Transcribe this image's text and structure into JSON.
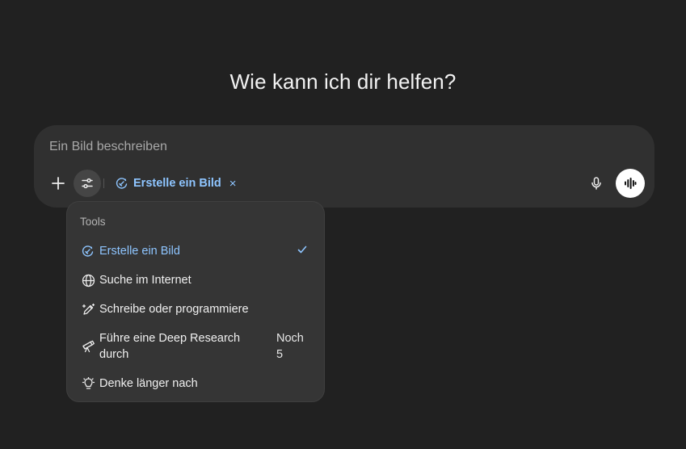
{
  "heading": "Wie kann ich dir helfen?",
  "composer": {
    "placeholder": "Ein Bild beschreiben",
    "active_tool_chip": "Erstelle ein Bild",
    "chip_remove": "×"
  },
  "tools_menu": {
    "header": "Tools",
    "items": [
      {
        "label": "Erstelle ein Bild",
        "icon": "image-create-icon",
        "selected": true
      },
      {
        "label": "Suche im Internet",
        "icon": "globe-icon"
      },
      {
        "label": "Schreibe oder programmiere",
        "icon": "pen-sparkle-icon"
      },
      {
        "label": "Führe eine Deep Research durch",
        "icon": "telescope-icon",
        "quota_label": "Noch",
        "quota_value": "5"
      },
      {
        "label": "Denke länger nach",
        "icon": "lightbulb-icon"
      }
    ]
  },
  "colors": {
    "background": "#212121",
    "composer": "#303030",
    "menu": "#353535",
    "accent": "#8ec5ff"
  }
}
